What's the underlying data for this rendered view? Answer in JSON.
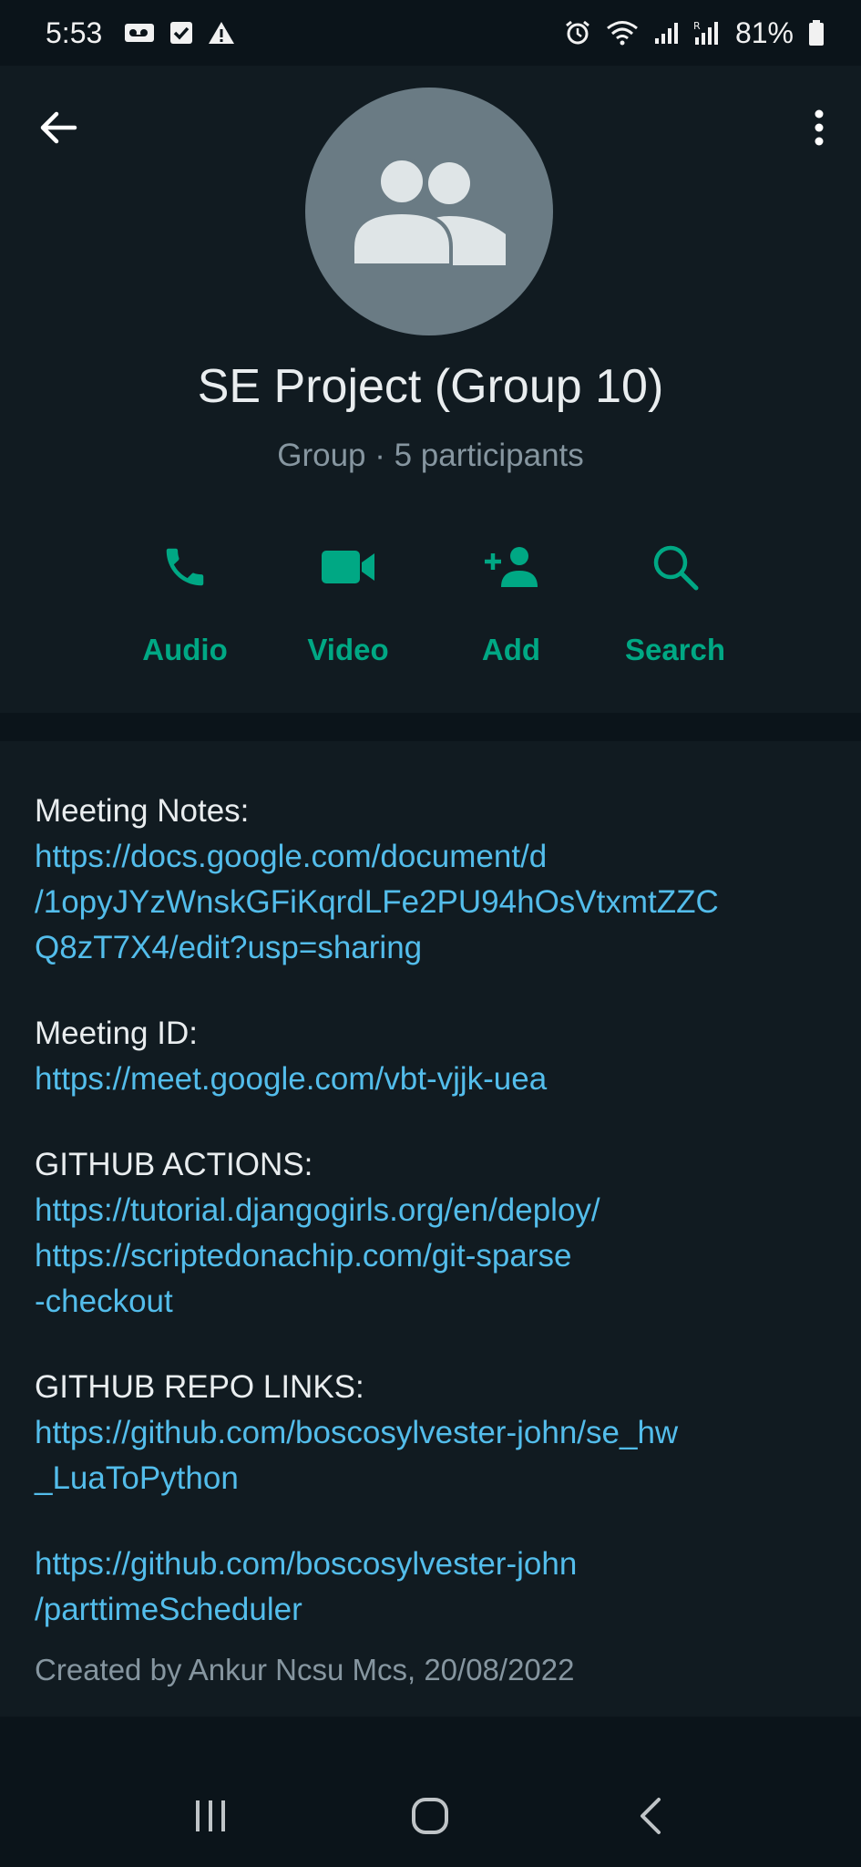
{
  "status_bar": {
    "time": "5:53",
    "battery": "81%",
    "left_icons": [
      "voicemail-icon",
      "checkbox-icon",
      "warning-icon"
    ],
    "right_icons": [
      "alarm-icon",
      "wifi-icon",
      "signal-icon",
      "signal-roaming-icon",
      "battery-icon"
    ]
  },
  "header": {
    "title": "SE Project (Group 10)",
    "subtitle": "Group · 5 participants"
  },
  "actions": [
    {
      "label": "Audio",
      "icon": "phone-icon"
    },
    {
      "label": "Video",
      "icon": "video-icon"
    },
    {
      "label": "Add",
      "icon": "add-person-icon"
    },
    {
      "label": "Search",
      "icon": "search-icon"
    }
  ],
  "description": {
    "meeting_notes_label": "Meeting Notes:",
    "meeting_notes_link_line1": "https://docs.google.com/document/d",
    "meeting_notes_link_line2": "/1opyJYzWnskGFiKqrdLFe2PU94hOsVtxmtZZC",
    "meeting_notes_link_line3": "Q8zT7X4/edit?usp=sharing",
    "meeting_id_label": "Meeting ID:",
    "meeting_id_link": "https://meet.google.com/vbt-vjjk-uea",
    "github_actions_label": "GITHUB ACTIONS:",
    "github_actions_link1": "https://tutorial.djangogirls.org/en/deploy/",
    "github_actions_link2_line1": "https://scriptedonachip.com/git-sparse",
    "github_actions_link2_line2": "-checkout",
    "github_repo_label": "GITHUB REPO LINKS:",
    "repo_link1_line1": "https://github.com/boscosylvester-john/se_hw",
    "repo_link1_line2": "_LuaToPython",
    "repo_link2_line1": "https://github.com/boscosylvester-john",
    "repo_link2_line2": "/parttimeScheduler",
    "created_by": "Created by Ankur Ncsu Mcs, 20/08/2022"
  },
  "colors": {
    "accent": "#00a884",
    "link": "#53bdeb",
    "background": "#0b141a",
    "panel": "#111b21"
  }
}
